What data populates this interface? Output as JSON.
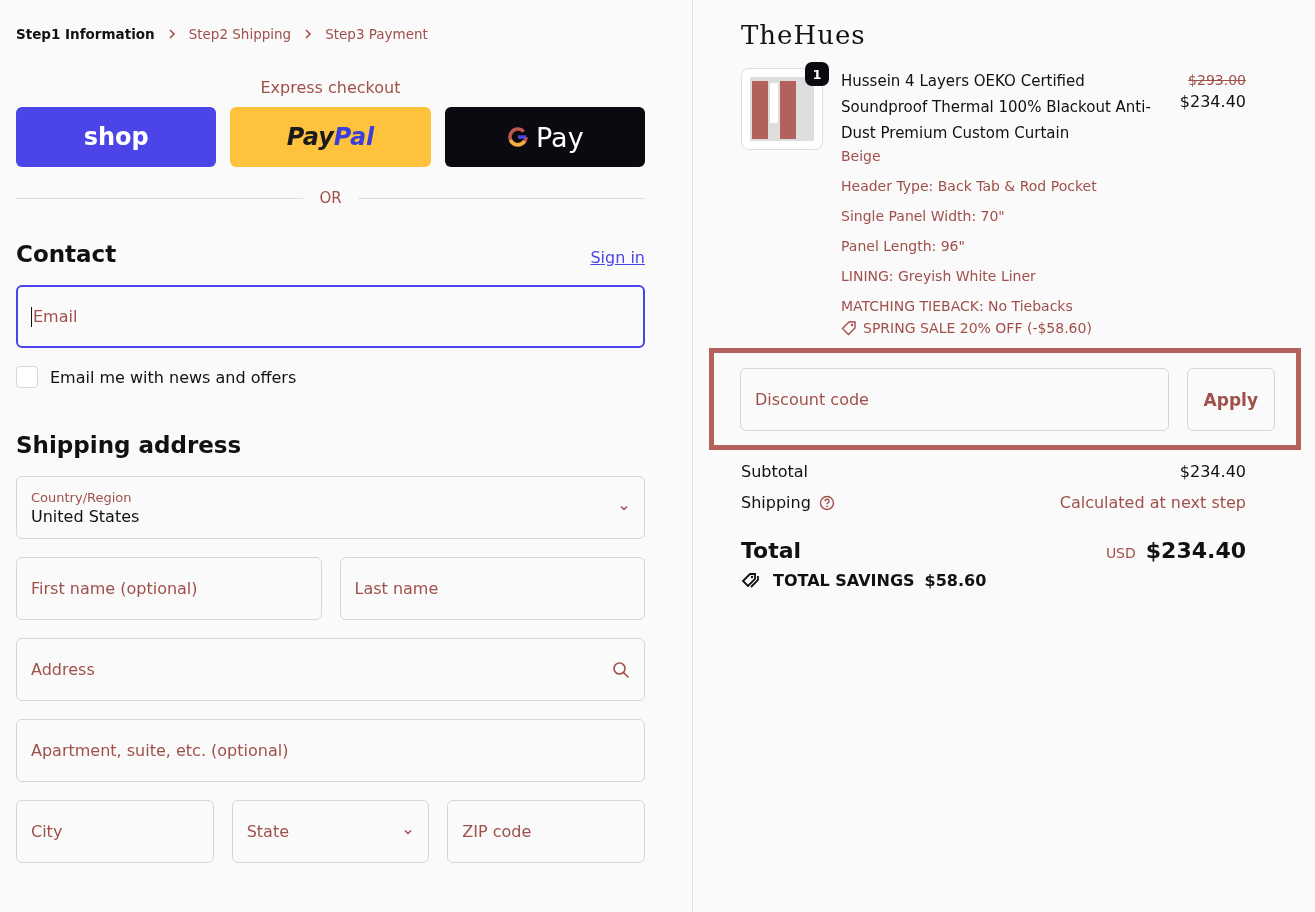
{
  "breadcrumbs": [
    {
      "label": "Step1 Information",
      "selected": true
    },
    {
      "label": "Step2 Shipping",
      "selected": false
    },
    {
      "label": "Step3 Payment",
      "selected": false
    }
  ],
  "express": {
    "title": "Express checkout",
    "buttons": [
      {
        "kind": "shop",
        "parts": [
          "shop"
        ]
      },
      {
        "kind": "paypal",
        "parts": [
          "Pay",
          "Pal"
        ]
      },
      {
        "kind": "gpay",
        "parts": [
          "Pay"
        ]
      }
    ]
  },
  "divider_label": "OR",
  "contact": {
    "title": "Contact",
    "sign_in": "Sign in",
    "email": {
      "placeholder": "Email",
      "focused": true
    },
    "newsletter": {
      "label": "Email me with news and offers",
      "checked": false
    }
  },
  "shipping": {
    "title": "Shipping address",
    "country": {
      "label": "Country/Region",
      "value": "United States"
    },
    "rows": [
      {
        "fields": [
          {
            "kind": "text",
            "placeholder": "First name (optional)"
          },
          {
            "kind": "text",
            "placeholder": "Last name"
          }
        ]
      },
      {
        "fields": [
          {
            "kind": "search",
            "placeholder": "Address"
          }
        ]
      },
      {
        "fields": [
          {
            "kind": "text",
            "placeholder": "Apartment, suite, etc. (optional)"
          }
        ]
      },
      {
        "fields": [
          {
            "kind": "text",
            "placeholder": "City"
          },
          {
            "kind": "select",
            "placeholder": "State"
          },
          {
            "kind": "text",
            "placeholder": "ZIP code"
          }
        ]
      }
    ]
  },
  "summary": {
    "brand": "TheHues",
    "item": {
      "quantity": "1",
      "name": "Hussein 4 Layers OEKO Certified Soundproof Thermal 100% Blackout Anti-Dust Premium Custom Curtain",
      "original_price": "$293.00",
      "price": "$234.40",
      "variant": "Beige",
      "options": [
        "Header Type: Back Tab & Rod Pocket",
        "Single Panel Width: 70\"",
        "Panel Length: 96\"",
        "LINING: Greyish White Liner",
        "MATCHING TIEBACK: No Tiebacks"
      ],
      "discount": "SPRING SALE 20% OFF (-$58.60)"
    },
    "discount_code": {
      "placeholder": "Discount code",
      "button": "Apply",
      "highlighted": true
    },
    "subtotal": {
      "label": "Subtotal",
      "value": "$234.40"
    },
    "shipping": {
      "label": "Shipping",
      "value": "Calculated at next step"
    },
    "total": {
      "label": "Total",
      "currency": "USD",
      "value": "$234.40"
    },
    "savings": {
      "label": "TOTAL SAVINGS",
      "value": "$58.60"
    }
  }
}
